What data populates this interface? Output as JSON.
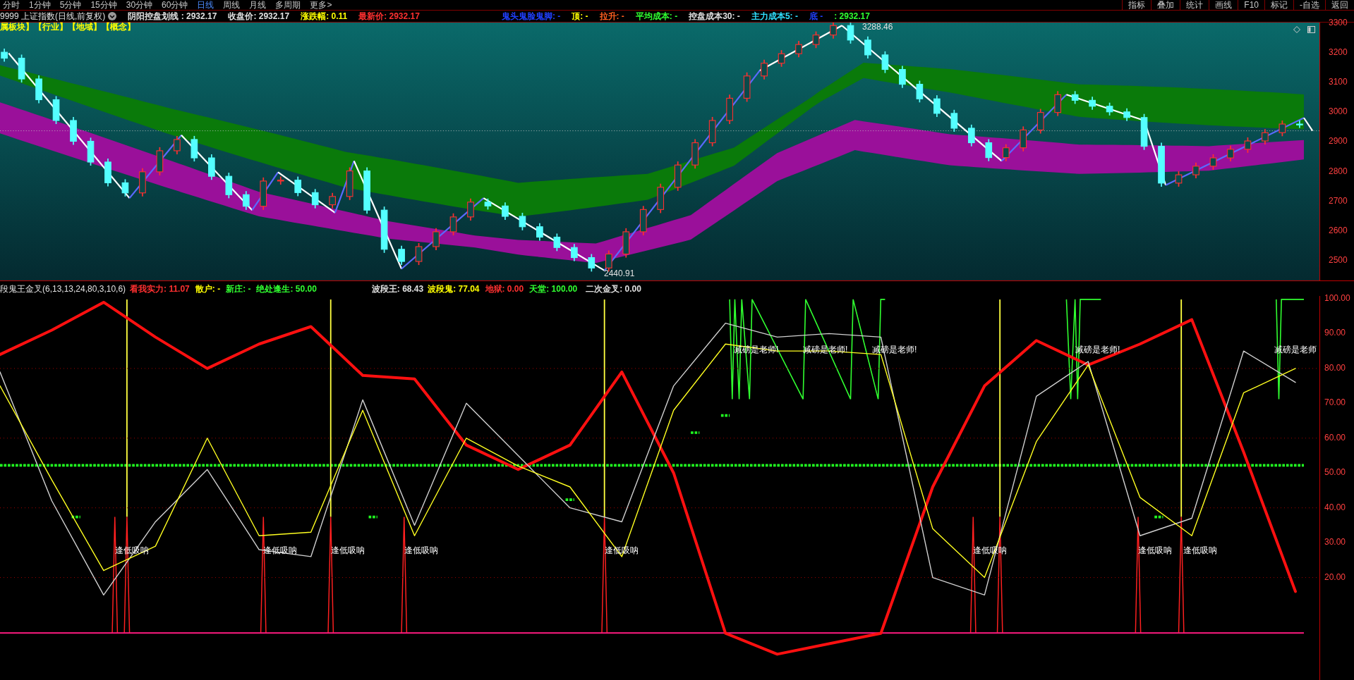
{
  "period_bar": {
    "periods": [
      {
        "label": "分时",
        "selected": false
      },
      {
        "label": "1分钟",
        "selected": false
      },
      {
        "label": "5分钟",
        "selected": false
      },
      {
        "label": "15分钟",
        "selected": false
      },
      {
        "label": "30分钟",
        "selected": false
      },
      {
        "label": "60分钟",
        "selected": false
      },
      {
        "label": "日线",
        "selected": true
      },
      {
        "label": "周线",
        "selected": false
      },
      {
        "label": "月线",
        "selected": false
      },
      {
        "label": "多周期",
        "selected": false
      },
      {
        "label": "更多>",
        "selected": false
      }
    ],
    "tools": [
      "指标",
      "叠加",
      "统计",
      "画线",
      "F10",
      "标记",
      "-自选",
      "返回"
    ]
  },
  "info_bar": {
    "security": "9999 上证指数(日线,前复权)",
    "items": [
      {
        "text": "阴阳控盘划线 : 2932.17",
        "color": "#e0e0e0"
      },
      {
        "text": "收盘价: 2932.17",
        "color": "#e0e0e0"
      },
      {
        "text": "涨跌幅: 0.11",
        "color": "#ffff00"
      },
      {
        "text": "最新价: 2932.17",
        "color": "#ff3030"
      },
      {
        "text": "鬼头鬼脸鬼脚: -",
        "color": "#2040ff"
      },
      {
        "text": "顶: -",
        "color": "#ffff00"
      },
      {
        "text": "拉升: -",
        "color": "#ff6020"
      },
      {
        "text": "平均成本: -",
        "color": "#30ff30"
      },
      {
        "text": "控盘成本30: -",
        "color": "#e0e0e0"
      },
      {
        "text": "主力成本5: -",
        "color": "#30e0ff"
      },
      {
        "text": "底  -",
        "color": "#2040ff"
      },
      {
        "text": ": 2932.17",
        "color": "#30ff30"
      }
    ]
  },
  "price_chart": {
    "sector_links": "属板块】【行业】【地域】【概念】",
    "annotations": [
      "3288.46",
      "2440.91"
    ],
    "chart_data": {
      "type": "candlestick",
      "ylim": [
        2431,
        3300
      ],
      "yticks": [
        {
          "value": 3300,
          "label": "3300"
        },
        {
          "value": 3200,
          "label": "3200"
        },
        {
          "value": 3100,
          "label": "3100"
        },
        {
          "value": 3000,
          "label": "3000"
        },
        {
          "value": 2900,
          "label": "2900"
        },
        {
          "value": 2800,
          "label": "2800"
        },
        {
          "value": 2700,
          "label": "2700"
        },
        {
          "value": 2600,
          "label": "2600"
        },
        {
          "value": 2500,
          "label": "2500"
        }
      ],
      "ohlc": [
        [
          3200,
          3212,
          3168,
          3180
        ],
        [
          3180,
          3192,
          3098,
          3110
        ],
        [
          3110,
          3122,
          3028,
          3040
        ],
        [
          3040,
          3052,
          2958,
          2970
        ],
        [
          2970,
          2982,
          2888,
          2900
        ],
        [
          2900,
          2912,
          2818,
          2830
        ],
        [
          2830,
          2842,
          2748,
          2760
        ],
        [
          2760,
          2772,
          2714,
          2726
        ],
        [
          2726,
          2809,
          2714,
          2797
        ],
        [
          2797,
          2880,
          2785,
          2868
        ],
        [
          2868,
          2918,
          2856,
          2906
        ],
        [
          2906,
          2918,
          2832,
          2844
        ],
        [
          2844,
          2856,
          2770,
          2782
        ],
        [
          2782,
          2794,
          2708,
          2720
        ],
        [
          2720,
          2732,
          2669,
          2681
        ],
        [
          2681,
          2778,
          2669,
          2766
        ],
        [
          2766,
          2781,
          2754,
          2769
        ],
        [
          2769,
          2781,
          2715,
          2727
        ],
        [
          2727,
          2739,
          2674,
          2686
        ],
        [
          2686,
          2726,
          2674,
          2714
        ],
        [
          2714,
          2812,
          2702,
          2800
        ],
        [
          2800,
          2812,
          2656,
          2668
        ],
        [
          2668,
          2680,
          2524,
          2536
        ],
        [
          2536,
          2548,
          2483,
          2495
        ],
        [
          2495,
          2557,
          2483,
          2545
        ],
        [
          2545,
          2607,
          2533,
          2595
        ],
        [
          2595,
          2657,
          2583,
          2645
        ],
        [
          2645,
          2707,
          2633,
          2695
        ],
        [
          2695,
          2707,
          2670,
          2682
        ],
        [
          2682,
          2694,
          2635,
          2647
        ],
        [
          2647,
          2659,
          2600,
          2612
        ],
        [
          2612,
          2624,
          2565,
          2577
        ],
        [
          2577,
          2589,
          2530,
          2542
        ],
        [
          2542,
          2554,
          2496,
          2508
        ],
        [
          2508,
          2520,
          2461,
          2473
        ],
        [
          2473,
          2532,
          2461,
          2520
        ],
        [
          2520,
          2607,
          2508,
          2595
        ],
        [
          2595,
          2682,
          2583,
          2670
        ],
        [
          2670,
          2757,
          2658,
          2745
        ],
        [
          2745,
          2832,
          2733,
          2820
        ],
        [
          2820,
          2907,
          2808,
          2895
        ],
        [
          2895,
          2982,
          2883,
          2970
        ],
        [
          2970,
          3057,
          2958,
          3045
        ],
        [
          3045,
          3132,
          3033,
          3120
        ],
        [
          3120,
          3175,
          3108,
          3163
        ],
        [
          3163,
          3207,
          3151,
          3195
        ],
        [
          3195,
          3238,
          3183,
          3226
        ],
        [
          3226,
          3270,
          3214,
          3258
        ],
        [
          3258,
          3302,
          3246,
          3290
        ],
        [
          3290,
          3302,
          3229,
          3241
        ],
        [
          3241,
          3253,
          3179,
          3191
        ],
        [
          3191,
          3203,
          3130,
          3142
        ],
        [
          3142,
          3154,
          3080,
          3092
        ],
        [
          3092,
          3104,
          3031,
          3043
        ],
        [
          3043,
          3055,
          2982,
          2994
        ],
        [
          2994,
          3006,
          2932,
          2944
        ],
        [
          2944,
          2956,
          2883,
          2895
        ],
        [
          2895,
          2907,
          2833,
          2845
        ],
        [
          2845,
          2890,
          2833,
          2878
        ],
        [
          2878,
          2950,
          2866,
          2938
        ],
        [
          2938,
          3009,
          2926,
          2997
        ],
        [
          2997,
          3069,
          2985,
          3057
        ],
        [
          3057,
          3069,
          3026,
          3038
        ],
        [
          3038,
          3050,
          3006,
          3018
        ],
        [
          3018,
          3030,
          2987,
          2999
        ],
        [
          2999,
          3011,
          2968,
          2980
        ],
        [
          2980,
          2992,
          2871,
          2883
        ],
        [
          2883,
          2895,
          2747,
          2759
        ],
        [
          2759,
          2799,
          2747,
          2787
        ],
        [
          2787,
          2828,
          2775,
          2816
        ],
        [
          2816,
          2856,
          2804,
          2844
        ],
        [
          2844,
          2885,
          2832,
          2873
        ],
        [
          2873,
          2913,
          2861,
          2901
        ],
        [
          2901,
          2941,
          2889,
          2929
        ],
        [
          2929,
          2970,
          2917,
          2958
        ],
        [
          2958,
          2970,
          2945,
          2957
        ]
      ]
    }
  },
  "indicator_header": {
    "title": "段鬼王金叉(6,13,13,24,80,3,10,6)",
    "items": [
      {
        "text": "看我实力: 11.07",
        "color": "#ff3030"
      },
      {
        "text": "散户: -",
        "color": "#ffff00"
      },
      {
        "text": "新庄: -",
        "color": "#30ff30"
      },
      {
        "text": "绝处逢生: 50.00",
        "color": "#30ff30"
      },
      {
        "text": "波段王: 68.43",
        "color": "#e0e0e0"
      },
      {
        "text": "波段鬼: 77.04",
        "color": "#ffff00"
      },
      {
        "text": "地狱: 0.00",
        "color": "#ff3030"
      },
      {
        "text": "天堂: 100.00",
        "color": "#30ff30"
      },
      {
        "text": "二次金叉: 0.00",
        "color": "#e0e0e0"
      }
    ]
  },
  "indicator_chart": {
    "labels": [
      {
        "text": "减磅是老师!"
      },
      {
        "text": "减磅是老师!"
      },
      {
        "text": "减磅是老师!"
      },
      {
        "text": "减磅是老师!"
      },
      {
        "text": "减磅是老师"
      },
      {
        "text": "逢低吸呐"
      },
      {
        "text": "逢低吸呐"
      },
      {
        "text": "逢低吸呐"
      },
      {
        "text": "逢低吸呐"
      },
      {
        "text": "逢低吸呐"
      },
      {
        "text": "逢低吸呐"
      },
      {
        "text": "逢低吸呐"
      },
      {
        "text": "逢低吸呐"
      }
    ],
    "chart_data": {
      "type": "line",
      "grid": true,
      "ylim": [
        -9,
        100.8
      ],
      "yticks": [
        {
          "value": 100,
          "label": "100.00"
        },
        {
          "value": 90,
          "label": "90.00"
        },
        {
          "value": 80,
          "label": "80.00"
        },
        {
          "value": 70,
          "label": "70.00"
        },
        {
          "value": 60,
          "label": "60.00"
        },
        {
          "value": 50,
          "label": "50.00"
        },
        {
          "value": 40,
          "label": "40.00"
        },
        {
          "value": 30,
          "label": "30.00"
        },
        {
          "value": 20,
          "label": "20.00"
        }
      ],
      "series": [
        {
          "color": "#ff1010",
          "values": [
            84,
            91,
            99,
            89,
            80,
            87,
            92,
            78,
            77,
            58,
            51,
            58,
            79,
            50,
            4,
            -2,
            1,
            4,
            46,
            75,
            88,
            81,
            87,
            94,
            56,
            16
          ]
        },
        {
          "color": "#d0d0d0",
          "values": [
            79,
            42,
            15,
            36,
            51,
            28,
            26,
            71,
            35,
            70,
            55,
            40,
            36,
            75,
            93,
            89,
            90,
            89,
            20,
            15,
            72,
            82,
            32,
            37,
            85,
            76
          ]
        },
        {
          "color": "#ffff20",
          "values": [
            75,
            48,
            22,
            29,
            60,
            32,
            33,
            68,
            32,
            60,
            52,
            46,
            26,
            68,
            87,
            85,
            85,
            84,
            34,
            20,
            59,
            81,
            43,
            32,
            73,
            80
          ]
        }
      ]
    }
  }
}
